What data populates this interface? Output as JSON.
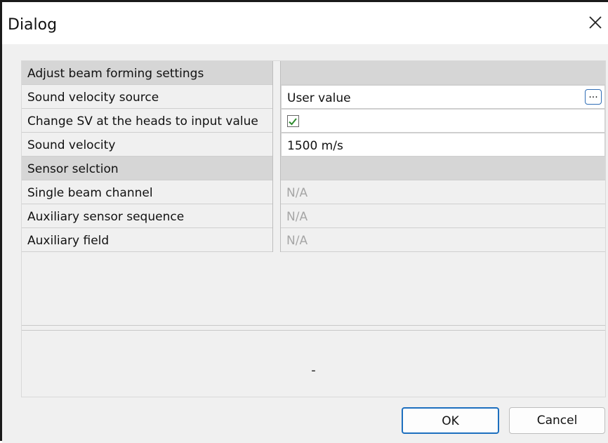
{
  "window": {
    "title": "Dialog"
  },
  "grid": {
    "rows": [
      {
        "type": "category",
        "label": "Adjust beam forming settings",
        "value": ""
      },
      {
        "type": "editable",
        "label": "Sound velocity source",
        "value": "User value",
        "has_ellipsis": true,
        "ellipsis_label": "..."
      },
      {
        "type": "editable",
        "label": "Change SV at the heads to input value",
        "checkbox": true,
        "checked": true
      },
      {
        "type": "editable",
        "label": "Sound velocity",
        "value": "1500 m/s"
      },
      {
        "type": "category",
        "label": "Sensor selction",
        "value": ""
      },
      {
        "type": "readonly",
        "label": "Single beam channel",
        "value": "N/A"
      },
      {
        "type": "readonly",
        "label": "Auxiliary sensor sequence",
        "value": "N/A"
      },
      {
        "type": "readonly",
        "label": "Auxiliary field",
        "value": "N/A"
      }
    ]
  },
  "description": {
    "text": "-"
  },
  "buttons": {
    "ok": "OK",
    "cancel": "Cancel"
  },
  "icons": {
    "close": "close-icon",
    "checkbox": "checkmark-icon"
  },
  "colors": {
    "accent": "#1d6fbf",
    "checkmark": "#2e8b2e",
    "category_bg": "#d6d6d6",
    "panel_bg": "#f0f0f0"
  }
}
